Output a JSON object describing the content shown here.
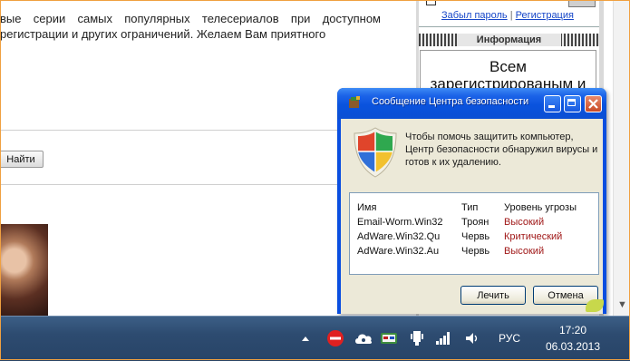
{
  "page": {
    "article_text": "вые серии самых популярных телесериалов при доступном регистрации и других ограничений. Желаем Вам приятного",
    "search_button": "Найти"
  },
  "sidebar": {
    "links": {
      "forgot": "Забыл пароль",
      "separator": "|",
      "register": "Регистрация"
    },
    "info_header": "Информация",
    "info_text": "Всем зарегистрированым и"
  },
  "dialog": {
    "title": "Сообщение Центра безопасности",
    "message": "Чтобы помочь защитить компьютер, Центр безопасности обнаружил вирусы и готов к их удалению.",
    "columns": {
      "name": "Имя",
      "type": "Тип",
      "level": "Уровень угрозы"
    },
    "rows": [
      {
        "name": "Email-Worm.Win32",
        "type": "Троян",
        "level": "Высокий"
      },
      {
        "name": "AdWare.Win32.Qu",
        "type": "Червь",
        "level": "Критический"
      },
      {
        "name": "AdWare.Win32.Au",
        "type": "Червь",
        "level": "Высокий"
      }
    ],
    "buttons": {
      "fix": "Лечить",
      "cancel": "Отмена"
    }
  },
  "taskbar": {
    "language": "РУС",
    "time": "17:20",
    "date": "06.03.2013",
    "tray_icons": [
      "show-hidden-icon",
      "mute-icon",
      "cloud-icon",
      "network-badge-icon",
      "usb-icon",
      "signal-icon",
      "volume-icon"
    ]
  },
  "colors": {
    "titlebar": "#0a53de",
    "dialog_body": "#ece9d8",
    "threat_level": "#a01818",
    "taskbar": "#2d4b70"
  }
}
